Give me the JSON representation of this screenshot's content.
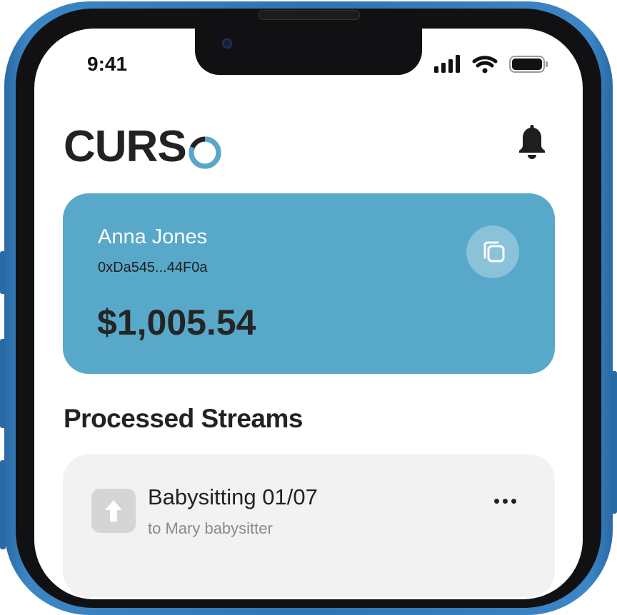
{
  "status_bar": {
    "time": "9:41"
  },
  "header": {
    "logo_text": "CURS",
    "notifications_icon": "bell-icon"
  },
  "account_card": {
    "name": "Anna Jones",
    "address": "0xDa545...44F0a",
    "balance": "$1,005.54",
    "copy_icon": "copy-icon",
    "color": "#58a8c9"
  },
  "section": {
    "title": "Processed Streams"
  },
  "streams": [
    {
      "title": "Babysitting 01/07",
      "subtitle": "to Mary babysitter",
      "icon": "arrow-up-icon",
      "menu_icon": "more-icon"
    }
  ],
  "colors": {
    "frame": "#2c74b4",
    "accent": "#58a8c9",
    "text": "#222222"
  }
}
